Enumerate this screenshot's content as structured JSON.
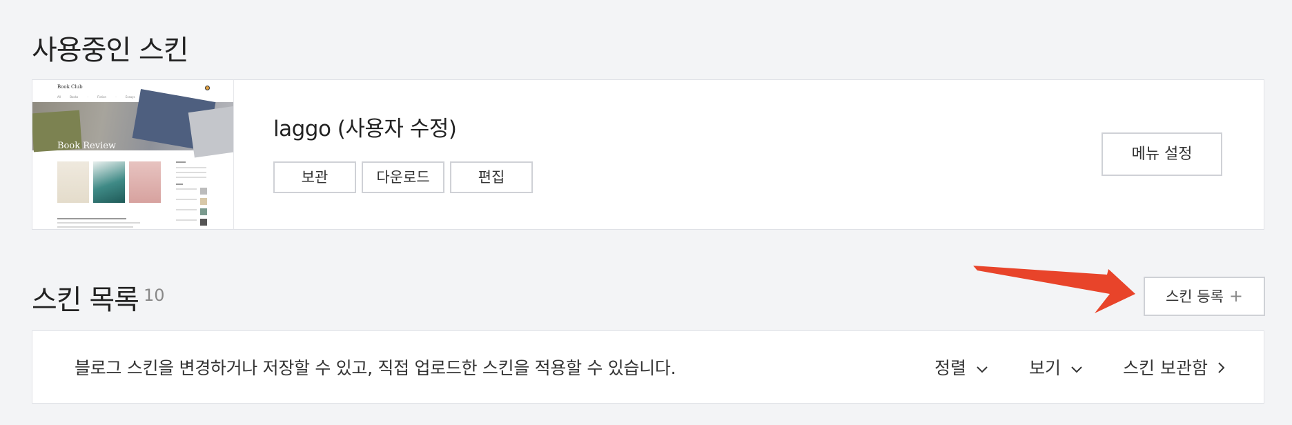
{
  "current_section": {
    "title": "사용중인 스킨",
    "thumbnail": {
      "site_name": "Book Club",
      "hero_text": "Book Review",
      "nav_text": "All Books · Fiction · Essays · About"
    },
    "skin_name": "laggo (사용자 수정)",
    "buttons": {
      "archive": "보관",
      "download": "다운로드",
      "edit": "편집",
      "menu_settings": "메뉴 설정"
    }
  },
  "list_section": {
    "title": "스킨 목록",
    "count": "10",
    "register_button": "스킨 등록",
    "register_icon": "+",
    "description": "블로그 스킨을 변경하거나 저장할 수 있고, 직접 업로드한 스킨을 적용할 수 있습니다.",
    "controls": {
      "sort": "정렬",
      "view": "보기",
      "storage": "스킨 보관함"
    }
  },
  "icons": {
    "sort": "chevron-down-icon",
    "view": "chevron-down-icon",
    "storage": "chevron-right-icon",
    "register": "plus-icon"
  },
  "colors": {
    "background": "#f3f4f6",
    "card": "#ffffff",
    "border": "#dfe1e6",
    "annotation_arrow": "#e8442a"
  }
}
